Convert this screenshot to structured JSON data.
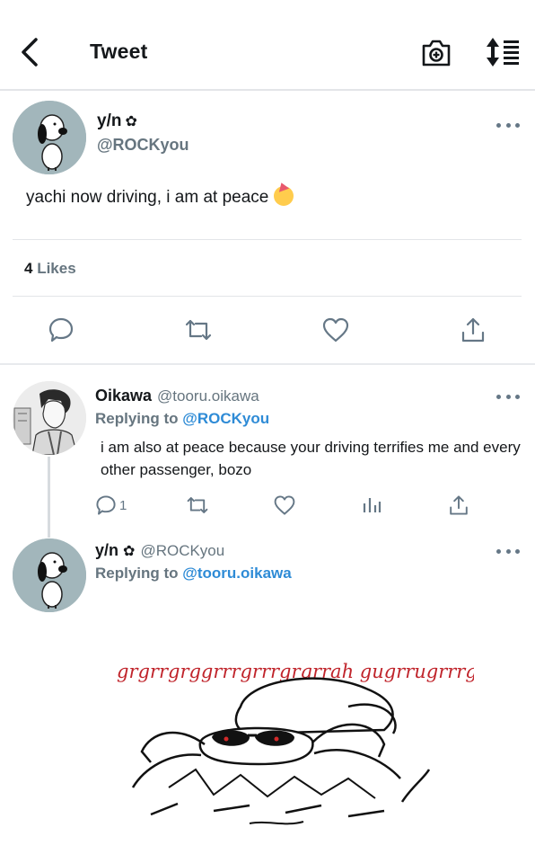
{
  "header": {
    "title": "Tweet",
    "icons": [
      "back-chevron-icon",
      "camera-plus-icon",
      "sort-icon"
    ]
  },
  "main_tweet": {
    "name": "y/n",
    "name_glyph": "✿",
    "handle": "@ROCKyou",
    "text": "yachi now driving, i am at peace",
    "likes_count": "4",
    "likes_label": "Likes",
    "emoji": "partying-face"
  },
  "replies": [
    {
      "name": "Oikawa",
      "handle": "@tooru.oikawa",
      "replying_label": "Replying to",
      "replying_to": "@ROCKyou",
      "text": "i am also at peace because your driving terrifies me and every other passenger, bozo",
      "reply_count": "1"
    },
    {
      "name": "y/n",
      "name_glyph": "✿",
      "handle": "@ROCKyou",
      "replying_label": "Replying to",
      "replying_to": "@tooru.oikawa",
      "image_caption": "grgrrgrggrrrgrrrgrgrrah gugrrugrrrgrrr"
    }
  ],
  "colors": {
    "link": "#2e8bd6",
    "secondary_text": "#66757f",
    "divider": "#e3e5e8",
    "drawing_text": "#c0242b"
  }
}
